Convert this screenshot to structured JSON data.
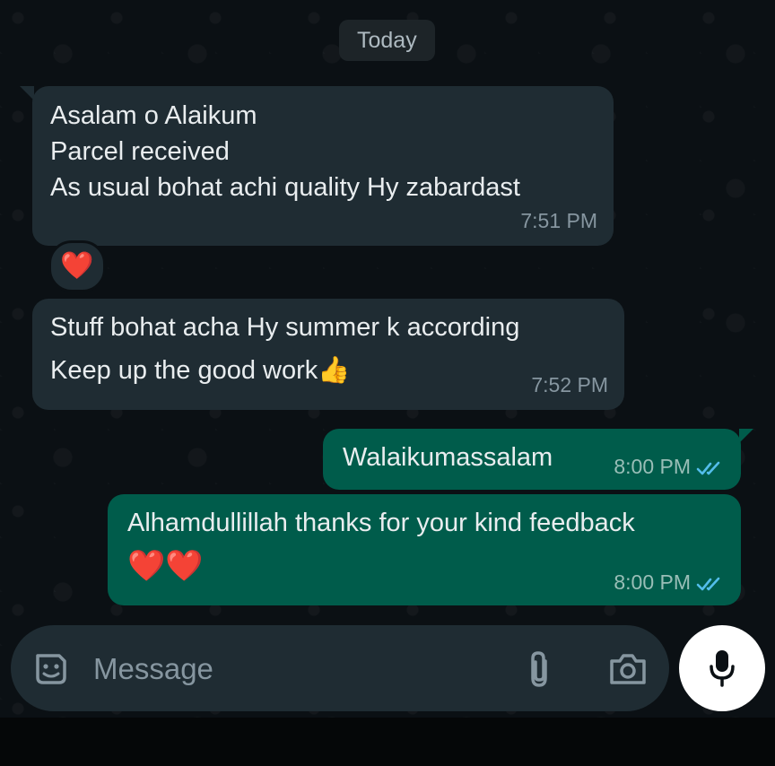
{
  "date_chip": "Today",
  "messages": [
    {
      "direction": "incoming",
      "lines": [
        "Asalam o Alaikum",
        "Parcel received",
        "As usual bohat achi quality Hy zabardast"
      ],
      "time": "7:51 PM",
      "reaction": "❤️"
    },
    {
      "direction": "incoming",
      "lines": [
        "Stuff bohat acha Hy summer k according",
        "Keep up the good work👍"
      ],
      "time": "7:52 PM"
    },
    {
      "direction": "outgoing",
      "lines": [
        "Walaikumassalam"
      ],
      "time": "8:00 PM",
      "status": "read"
    },
    {
      "direction": "outgoing",
      "lines": [
        "Alhamdullillah thanks for your kind feedback",
        "❤️❤️"
      ],
      "time": "8:00 PM",
      "status": "read"
    }
  ],
  "composer": {
    "placeholder": "Message",
    "icons": [
      "sticker-icon",
      "attach-icon",
      "camera-icon",
      "mic-icon"
    ]
  },
  "colors": {
    "background": "#0b1014",
    "incoming_bubble": "#1f2c33",
    "outgoing_bubble": "#005c4b",
    "read_ticks": "#53bdeb"
  }
}
